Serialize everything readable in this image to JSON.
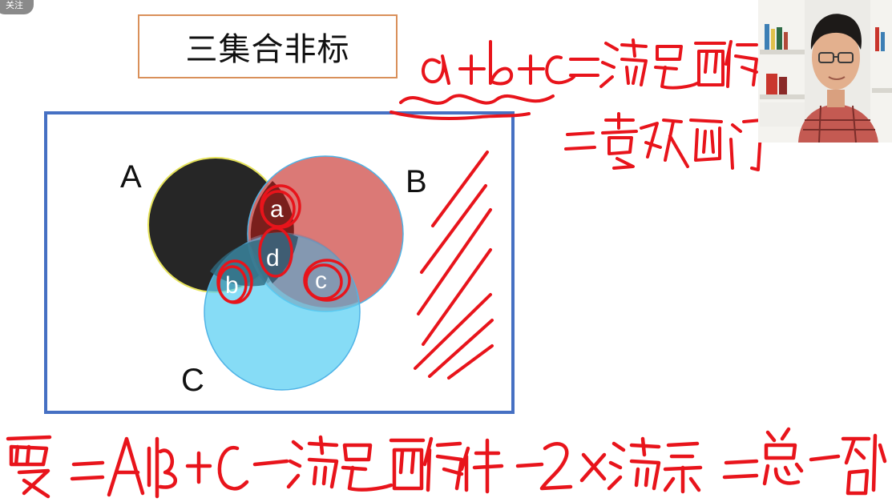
{
  "follow_label": "关注",
  "title": "三集合非标",
  "venn": {
    "sets": [
      {
        "label": "A",
        "color": "#262626"
      },
      {
        "label": "B",
        "color": "#d96c6c"
      },
      {
        "label": "C",
        "color": "#5ed0f3"
      }
    ],
    "regions": [
      {
        "label": "a"
      },
      {
        "label": "d"
      },
      {
        "label": "b"
      },
      {
        "label": "c"
      }
    ],
    "frame_color": "#4670c3"
  },
  "handwriting": {
    "ink_color": "#e8141b",
    "line1": "a+b+c = 满足两个条件",
    "line2": "= 喜欢两门",
    "bottom": "覆 = A+B+C − 满足两个条件 − 2x满三 = 总 − 都不"
  }
}
